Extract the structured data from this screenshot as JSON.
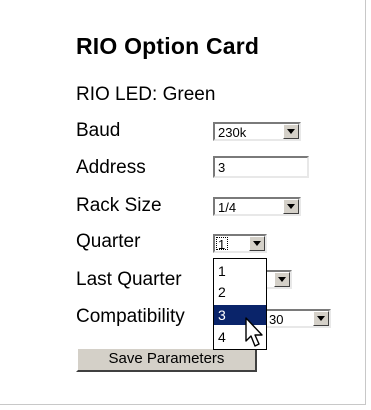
{
  "title": "RIO Option Card",
  "led": {
    "label": "RIO LED:",
    "value": "Green"
  },
  "baud": {
    "label": "Baud",
    "value": "230k"
  },
  "address": {
    "label": "Address",
    "value": "3"
  },
  "rack_size": {
    "label": "Rack Size",
    "value": "1/4"
  },
  "quarter": {
    "label": "Quarter",
    "value": "1",
    "options": [
      "1",
      "2",
      "3",
      "4"
    ],
    "highlighted": "3"
  },
  "last_quarter": {
    "label": "Last Quarter"
  },
  "compatibility": {
    "label": "Compatibility",
    "value_partial": "30"
  },
  "save_button": {
    "label": "Save Parameters"
  },
  "colors": {
    "highlight": "#0a246a",
    "button_face": "#d4d0c8"
  },
  "icons": {
    "dropdown": "chevron-down-icon",
    "cursor": "mouse-pointer-icon"
  }
}
